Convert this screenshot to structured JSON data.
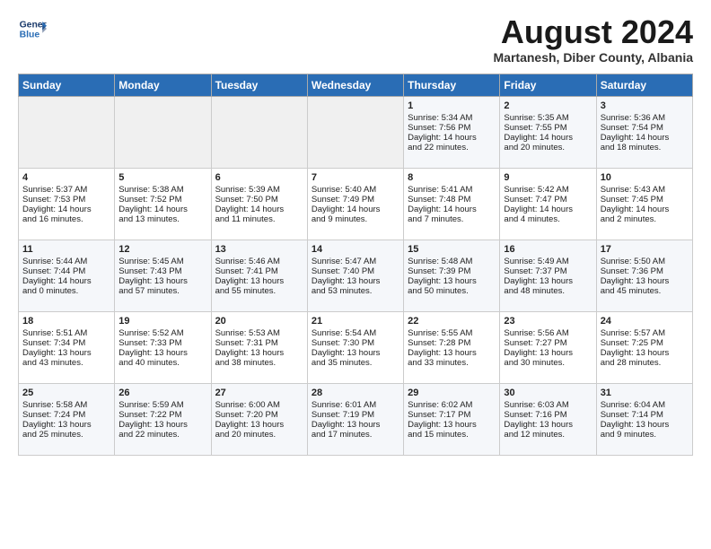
{
  "header": {
    "logo_line1": "General",
    "logo_line2": "Blue",
    "month_title": "August 2024",
    "location": "Martanesh, Diber County, Albania"
  },
  "weekdays": [
    "Sunday",
    "Monday",
    "Tuesday",
    "Wednesday",
    "Thursday",
    "Friday",
    "Saturday"
  ],
  "weeks": [
    [
      {
        "day": "",
        "info": ""
      },
      {
        "day": "",
        "info": ""
      },
      {
        "day": "",
        "info": ""
      },
      {
        "day": "",
        "info": ""
      },
      {
        "day": "1",
        "info": "Sunrise: 5:34 AM\nSunset: 7:56 PM\nDaylight: 14 hours\nand 22 minutes."
      },
      {
        "day": "2",
        "info": "Sunrise: 5:35 AM\nSunset: 7:55 PM\nDaylight: 14 hours\nand 20 minutes."
      },
      {
        "day": "3",
        "info": "Sunrise: 5:36 AM\nSunset: 7:54 PM\nDaylight: 14 hours\nand 18 minutes."
      }
    ],
    [
      {
        "day": "4",
        "info": "Sunrise: 5:37 AM\nSunset: 7:53 PM\nDaylight: 14 hours\nand 16 minutes."
      },
      {
        "day": "5",
        "info": "Sunrise: 5:38 AM\nSunset: 7:52 PM\nDaylight: 14 hours\nand 13 minutes."
      },
      {
        "day": "6",
        "info": "Sunrise: 5:39 AM\nSunset: 7:50 PM\nDaylight: 14 hours\nand 11 minutes."
      },
      {
        "day": "7",
        "info": "Sunrise: 5:40 AM\nSunset: 7:49 PM\nDaylight: 14 hours\nand 9 minutes."
      },
      {
        "day": "8",
        "info": "Sunrise: 5:41 AM\nSunset: 7:48 PM\nDaylight: 14 hours\nand 7 minutes."
      },
      {
        "day": "9",
        "info": "Sunrise: 5:42 AM\nSunset: 7:47 PM\nDaylight: 14 hours\nand 4 minutes."
      },
      {
        "day": "10",
        "info": "Sunrise: 5:43 AM\nSunset: 7:45 PM\nDaylight: 14 hours\nand 2 minutes."
      }
    ],
    [
      {
        "day": "11",
        "info": "Sunrise: 5:44 AM\nSunset: 7:44 PM\nDaylight: 14 hours\nand 0 minutes."
      },
      {
        "day": "12",
        "info": "Sunrise: 5:45 AM\nSunset: 7:43 PM\nDaylight: 13 hours\nand 57 minutes."
      },
      {
        "day": "13",
        "info": "Sunrise: 5:46 AM\nSunset: 7:41 PM\nDaylight: 13 hours\nand 55 minutes."
      },
      {
        "day": "14",
        "info": "Sunrise: 5:47 AM\nSunset: 7:40 PM\nDaylight: 13 hours\nand 53 minutes."
      },
      {
        "day": "15",
        "info": "Sunrise: 5:48 AM\nSunset: 7:39 PM\nDaylight: 13 hours\nand 50 minutes."
      },
      {
        "day": "16",
        "info": "Sunrise: 5:49 AM\nSunset: 7:37 PM\nDaylight: 13 hours\nand 48 minutes."
      },
      {
        "day": "17",
        "info": "Sunrise: 5:50 AM\nSunset: 7:36 PM\nDaylight: 13 hours\nand 45 minutes."
      }
    ],
    [
      {
        "day": "18",
        "info": "Sunrise: 5:51 AM\nSunset: 7:34 PM\nDaylight: 13 hours\nand 43 minutes."
      },
      {
        "day": "19",
        "info": "Sunrise: 5:52 AM\nSunset: 7:33 PM\nDaylight: 13 hours\nand 40 minutes."
      },
      {
        "day": "20",
        "info": "Sunrise: 5:53 AM\nSunset: 7:31 PM\nDaylight: 13 hours\nand 38 minutes."
      },
      {
        "day": "21",
        "info": "Sunrise: 5:54 AM\nSunset: 7:30 PM\nDaylight: 13 hours\nand 35 minutes."
      },
      {
        "day": "22",
        "info": "Sunrise: 5:55 AM\nSunset: 7:28 PM\nDaylight: 13 hours\nand 33 minutes."
      },
      {
        "day": "23",
        "info": "Sunrise: 5:56 AM\nSunset: 7:27 PM\nDaylight: 13 hours\nand 30 minutes."
      },
      {
        "day": "24",
        "info": "Sunrise: 5:57 AM\nSunset: 7:25 PM\nDaylight: 13 hours\nand 28 minutes."
      }
    ],
    [
      {
        "day": "25",
        "info": "Sunrise: 5:58 AM\nSunset: 7:24 PM\nDaylight: 13 hours\nand 25 minutes."
      },
      {
        "day": "26",
        "info": "Sunrise: 5:59 AM\nSunset: 7:22 PM\nDaylight: 13 hours\nand 22 minutes."
      },
      {
        "day": "27",
        "info": "Sunrise: 6:00 AM\nSunset: 7:20 PM\nDaylight: 13 hours\nand 20 minutes."
      },
      {
        "day": "28",
        "info": "Sunrise: 6:01 AM\nSunset: 7:19 PM\nDaylight: 13 hours\nand 17 minutes."
      },
      {
        "day": "29",
        "info": "Sunrise: 6:02 AM\nSunset: 7:17 PM\nDaylight: 13 hours\nand 15 minutes."
      },
      {
        "day": "30",
        "info": "Sunrise: 6:03 AM\nSunset: 7:16 PM\nDaylight: 13 hours\nand 12 minutes."
      },
      {
        "day": "31",
        "info": "Sunrise: 6:04 AM\nSunset: 7:14 PM\nDaylight: 13 hours\nand 9 minutes."
      }
    ]
  ]
}
